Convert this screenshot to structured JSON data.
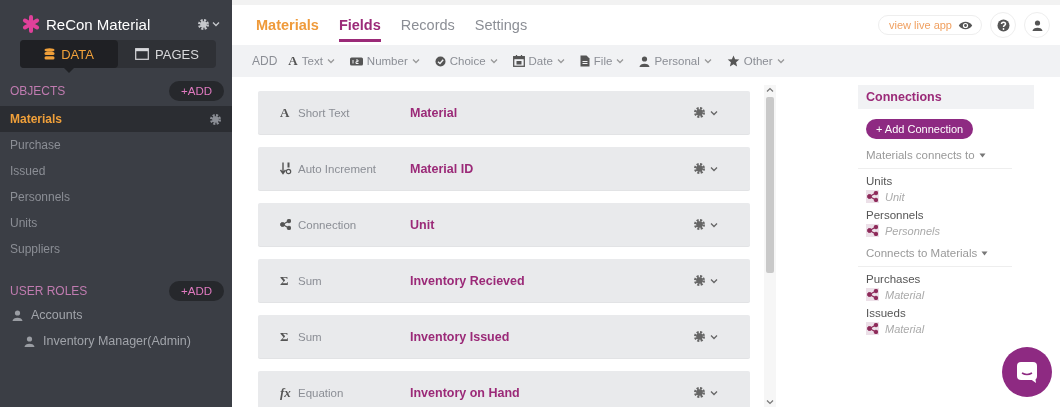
{
  "sidebar": {
    "app_name": "ReCon Material",
    "tabs": [
      {
        "label": "DATA",
        "kind": "database",
        "selected": true
      },
      {
        "label": "PAGES",
        "kind": "window",
        "selected": false
      }
    ],
    "objects": {
      "heading": "OBJECTS",
      "add_label": "+ADD",
      "items": [
        {
          "label": "Materials",
          "selected": true
        },
        {
          "label": "Purchase",
          "selected": false
        },
        {
          "label": "Issued",
          "selected": false
        },
        {
          "label": "Personnels",
          "selected": false
        },
        {
          "label": "Units",
          "selected": false
        },
        {
          "label": "Suppliers",
          "selected": false
        }
      ]
    },
    "user_roles": {
      "heading": "USER ROLES",
      "add_label": "+ADD",
      "items": [
        {
          "label": "Accounts",
          "children": [
            {
              "label": "Inventory Manager(Admin)"
            }
          ]
        }
      ]
    }
  },
  "header": {
    "object_title": "Materials",
    "tabs": [
      {
        "label": "Fields",
        "selected": true
      },
      {
        "label": "Records",
        "selected": false
      },
      {
        "label": "Settings",
        "selected": false
      }
    ],
    "live_app_label": "view live app"
  },
  "toolbar": {
    "add_label": "ADD",
    "items": [
      {
        "label": "Text",
        "kind": "glyph",
        "glyph": "A"
      },
      {
        "label": "Number",
        "kind": "number"
      },
      {
        "label": "Choice",
        "kind": "choice"
      },
      {
        "label": "Date",
        "kind": "date"
      },
      {
        "label": "File",
        "kind": "file"
      },
      {
        "label": "Personal",
        "kind": "person"
      },
      {
        "label": "Other",
        "kind": "star"
      }
    ]
  },
  "fields": [
    {
      "type": "Short Text",
      "kind": "glyph",
      "glyph": "A",
      "name": "Material"
    },
    {
      "type": "Auto Increment",
      "kind": "sort",
      "name": "Material ID"
    },
    {
      "type": "Connection",
      "kind": "share",
      "name": "Unit"
    },
    {
      "type": "Sum",
      "kind": "glyph",
      "glyph": "Σ",
      "name": "Inventory Recieved"
    },
    {
      "type": "Sum",
      "kind": "glyph",
      "glyph": "Σ",
      "name": "Inventory Issued"
    },
    {
      "type": "Equation",
      "kind": "glyph",
      "glyph": "fx",
      "name": "Inventory on Hand"
    }
  ],
  "connections": {
    "title": "Connections",
    "add_label": "+ Add Connection",
    "groups": [
      {
        "heading": "Materials connects to",
        "items": [
          {
            "object": "Units",
            "field": "Unit"
          },
          {
            "object": "Personnels",
            "field": "Personnels"
          }
        ]
      },
      {
        "heading": "Connects to Materials",
        "items": [
          {
            "object": "Purchases",
            "field": "Material"
          },
          {
            "object": "Issueds",
            "field": "Material"
          }
        ]
      }
    ]
  }
}
